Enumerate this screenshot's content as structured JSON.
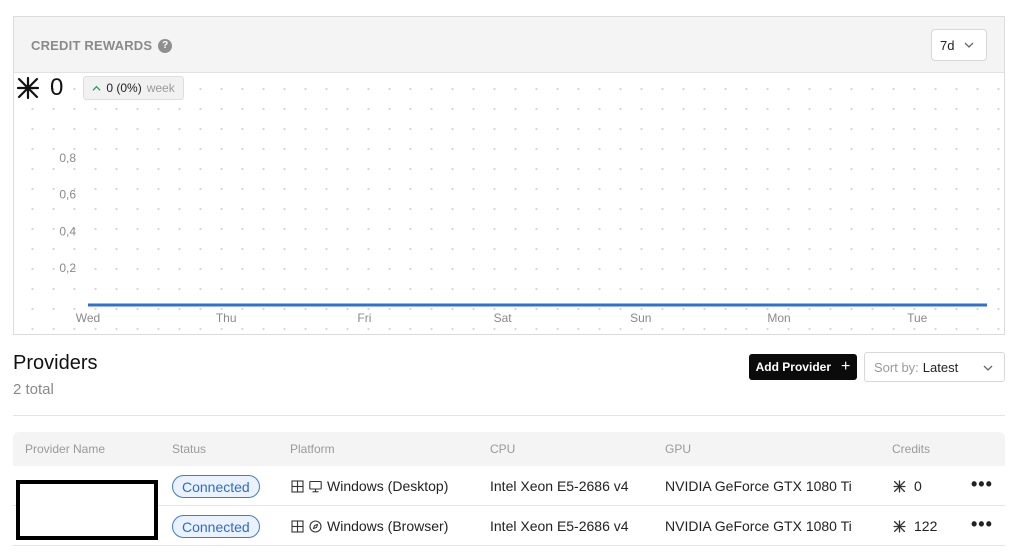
{
  "credit_rewards": {
    "title": "CREDIT REWARDS",
    "help_glyph": "?",
    "range": "7d",
    "total": "0",
    "change": "0 (0%)",
    "change_period": "week"
  },
  "chart_data": {
    "type": "line",
    "categories": [
      "Wed",
      "Thu",
      "Fri",
      "Sat",
      "Sun",
      "Mon",
      "Tue"
    ],
    "series": [
      {
        "values": [
          0,
          0,
          0,
          0,
          0,
          0,
          0,
          0
        ],
        "color": "#2f6fd6"
      }
    ],
    "y_ticks": [
      "0,2",
      "0,4",
      "0,6",
      "0,8"
    ],
    "ylim": [
      0,
      1
    ],
    "grid": "dotted"
  },
  "providers": {
    "title": "Providers",
    "count": "2 total",
    "add_button": "Add Provider",
    "add_glyph": "+",
    "sort_prefix": "Sort by:",
    "sort_value": "Latest",
    "columns": [
      "Provider Name",
      "Status",
      "Platform",
      "CPU",
      "GPU",
      "Credits"
    ],
    "rows": [
      {
        "status": "Connected",
        "platform": "Windows (Desktop)",
        "platform_icon": "desktop-icon",
        "cpu": "Intel Xeon E5-2686 v4",
        "gpu": "NVIDIA GeForce GTX 1080 Ti",
        "credits": "0",
        "more": "•••"
      },
      {
        "status": "Connected",
        "platform": "Windows (Browser)",
        "platform_icon": "browser-icon",
        "cpu": "Intel Xeon E5-2686 v4",
        "gpu": "NVIDIA GeForce GTX 1080 Ti",
        "credits": "122",
        "more": "•••"
      }
    ]
  },
  "colors": {
    "accent_line": "#2f6fd6",
    "status_border": "#3f7ad8",
    "status_bg": "#eaf2ff",
    "button_bg": "#0b0b0b",
    "trend_up": "#1fa35a"
  }
}
